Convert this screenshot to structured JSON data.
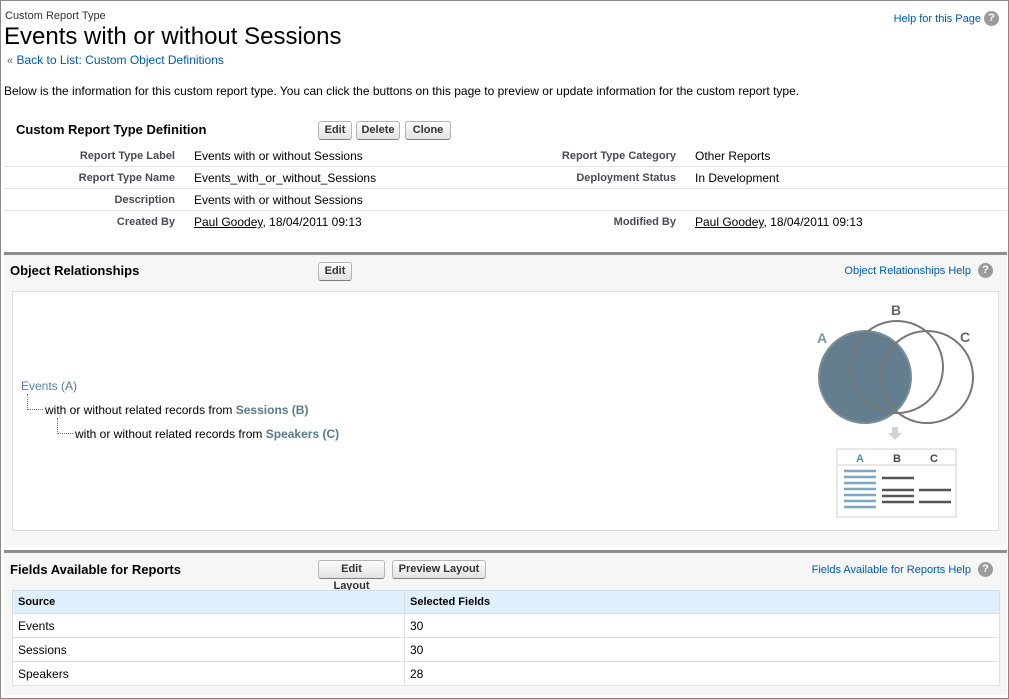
{
  "header": {
    "page_type": "Custom Report Type",
    "title": "Events with or without Sessions",
    "back_arrow": "«",
    "back_link": "Back to List: Custom Object Definitions",
    "help_link": "Help for this Page",
    "help_icon": "?"
  },
  "intro": "Below is the information for this custom report type. You can click the buttons on this page to preview or update information for the custom report type.",
  "definition": {
    "title": "Custom Report Type Definition",
    "buttons": {
      "edit": "Edit",
      "delete": "Delete",
      "clone": "Clone"
    },
    "report_type_label": {
      "label": "Report Type Label",
      "value": "Events with or without Sessions"
    },
    "report_type_category": {
      "label": "Report Type Category",
      "value": "Other Reports"
    },
    "report_type_name": {
      "label": "Report Type Name",
      "value": "Events_with_or_without_Sessions"
    },
    "deployment_status": {
      "label": "Deployment Status",
      "value": "In Development"
    },
    "description": {
      "label": "Description",
      "value": "Events with or without Sessions"
    },
    "created_by": {
      "label": "Created By",
      "user": "Paul Goodey",
      "date": ", 18/04/2011 09:13"
    },
    "modified_by": {
      "label": "Modified By",
      "user": "Paul Goodey",
      "date": ", 18/04/2011 09:13"
    }
  },
  "relationships": {
    "title": "Object Relationships",
    "edit_button": "Edit",
    "help_link": "Object Relationships Help",
    "tree": {
      "a": "Events (A)",
      "b_prefix": "with or without related records from ",
      "b_object": "Sessions (B)",
      "c_prefix": "with or without related records from ",
      "c_object": "Speakers (C)"
    },
    "diagram": {
      "labels": [
        "A",
        "B",
        "C"
      ],
      "table_headers": [
        "A",
        "B",
        "C"
      ],
      "colors": {
        "primary": "#607b8c",
        "circle_stroke": "#777777",
        "accent": "#5a7a8e"
      }
    }
  },
  "fields": {
    "title": "Fields Available for Reports",
    "edit_layout_button": "Edit Layout",
    "preview_layout_button": "Preview Layout",
    "help_link": "Fields Available for Reports Help",
    "columns": [
      "Source",
      "Selected Fields"
    ],
    "rows": [
      {
        "source": "Events",
        "count": "30"
      },
      {
        "source": "Sessions",
        "count": "30"
      },
      {
        "source": "Speakers",
        "count": "28"
      }
    ]
  }
}
